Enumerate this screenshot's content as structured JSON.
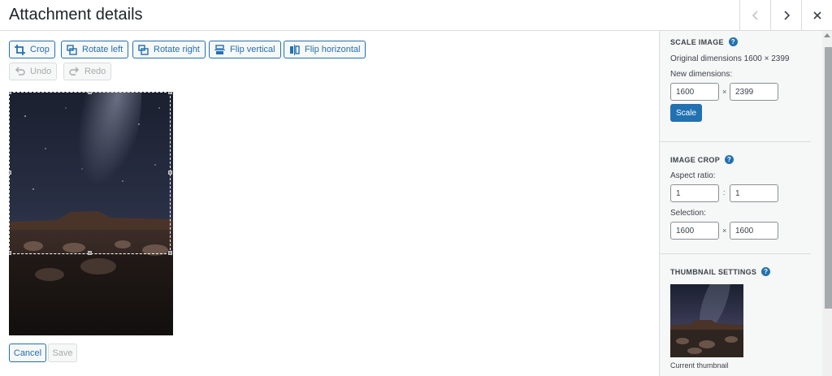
{
  "header": {
    "title": "Attachment details",
    "prev_icon": "chevron-left-icon",
    "next_icon": "chevron-right-icon",
    "close_icon": "close-icon"
  },
  "toolbar": {
    "crop": "Crop",
    "rotate_left": "Rotate left",
    "rotate_right": "Rotate right",
    "flip_vertical": "Flip vertical",
    "flip_horizontal": "Flip horizontal",
    "undo": "Undo",
    "redo": "Redo"
  },
  "footer": {
    "cancel": "Cancel",
    "save": "Save"
  },
  "sidebar": {
    "scale": {
      "title": "SCALE IMAGE",
      "original": "Original dimensions 1600 × 2399",
      "new_label": "New dimensions:",
      "width": "1600",
      "height": "2399",
      "times": "×",
      "button": "Scale"
    },
    "crop": {
      "title": "IMAGE CROP",
      "aspect_label": "Aspect ratio:",
      "aspect_w": "1",
      "aspect_h": "1",
      "colon": ":",
      "selection_label": "Selection:",
      "sel_w": "1600",
      "sel_h": "1600",
      "times": "×"
    },
    "thumbnail": {
      "title": "THUMBNAIL SETTINGS",
      "caption": "Current thumbnail"
    },
    "help_glyph": "?"
  },
  "colors": {
    "accent": "#2271b1",
    "border": "#dcdcde",
    "sidebar_bg": "#f6f7f7"
  }
}
